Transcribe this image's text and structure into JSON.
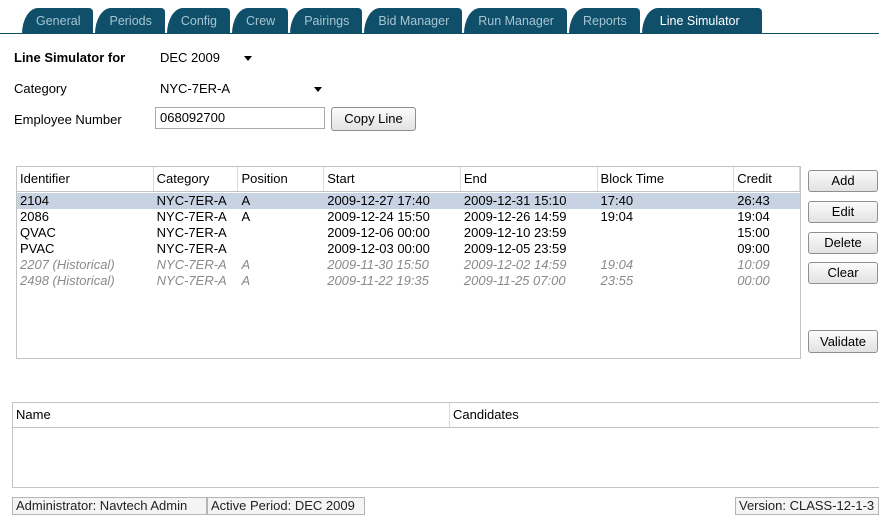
{
  "tabs": [
    "General",
    "Periods",
    "Config",
    "Crew",
    "Pairings",
    "Bid Manager",
    "Run Manager",
    "Reports",
    "Line Simulator"
  ],
  "active_tab": "Line Simulator",
  "form": {
    "line_sim_label": "Line Simulator for",
    "period_value": "DEC 2009",
    "category_label": "Category",
    "category_value": "NYC-7ER-A",
    "employee_label": "Employee Number",
    "employee_value": "068092700",
    "copy_line_label": "Copy Line"
  },
  "table": {
    "columns": [
      "Identifier",
      "Category",
      "Position",
      "Start",
      "End",
      "Block Time",
      "Credit"
    ],
    "rows": [
      {
        "cells": [
          "2104",
          "NYC-7ER-A",
          "A",
          "2009-12-27 17:40",
          "2009-12-31 15:10",
          "17:40",
          "26:43"
        ],
        "selected": true,
        "historical": false
      },
      {
        "cells": [
          "2086",
          "NYC-7ER-A",
          "A",
          "2009-12-24 15:50",
          "2009-12-26 14:59",
          "19:04",
          "19:04"
        ],
        "selected": false,
        "historical": false
      },
      {
        "cells": [
          "QVAC",
          "NYC-7ER-A",
          "",
          "2009-12-06 00:00",
          "2009-12-10 23:59",
          "",
          "15:00"
        ],
        "selected": false,
        "historical": false
      },
      {
        "cells": [
          "PVAC",
          "NYC-7ER-A",
          "",
          "2009-12-03 00:00",
          "2009-12-05 23:59",
          "",
          "09:00"
        ],
        "selected": false,
        "historical": false
      },
      {
        "cells": [
          "2207 (Historical)",
          "NYC-7ER-A",
          "A",
          "2009-11-30 15:50",
          "2009-12-02 14:59",
          "19:04",
          "10:09"
        ],
        "selected": false,
        "historical": true
      },
      {
        "cells": [
          "2498 (Historical)",
          "NYC-7ER-A",
          "A",
          "2009-11-22 19:35",
          "2009-11-25 07:00",
          "23:55",
          "00:00"
        ],
        "selected": false,
        "historical": true
      }
    ]
  },
  "buttons": {
    "add": "Add",
    "edit": "Edit",
    "delete": "Delete",
    "clear": "Clear",
    "validate": "Validate"
  },
  "candidates_table": {
    "columns": [
      "Name",
      "Candidates"
    ]
  },
  "status_bar": {
    "admin": "Administrator: Navtech Admin",
    "period": "Active Period: DEC 2009",
    "version": "Version: CLASS-12-1-3"
  }
}
